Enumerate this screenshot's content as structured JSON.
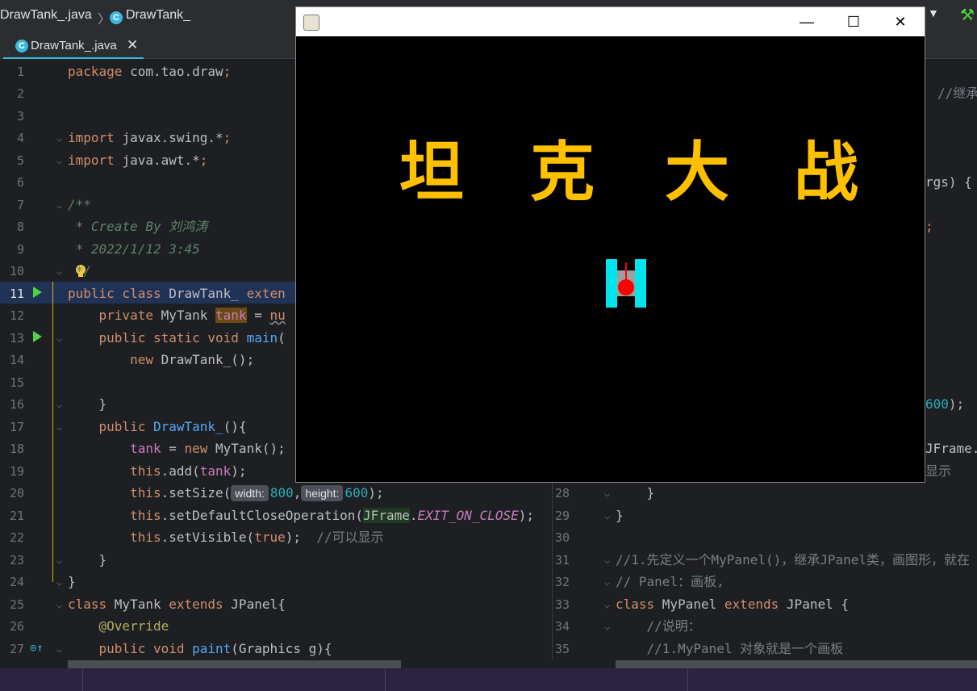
{
  "breadcrumb": {
    "file": "DrawTank_.java",
    "class": "DrawTank_",
    "sep": "〉"
  },
  "tab": {
    "label": "DrawTank_.java",
    "close": "✕"
  },
  "editor": {
    "line_numbers": [
      "1",
      "2",
      "3",
      "4",
      "5",
      "6",
      "7",
      "8",
      "9",
      "10",
      "11",
      "12",
      "13",
      "14",
      "15",
      "16",
      "17",
      "18",
      "19",
      "20",
      "21",
      "22",
      "23",
      "24",
      "25",
      "26",
      "27"
    ],
    "l1a": "package ",
    "l1b": "com.tao.draw",
    "l1c": ";",
    "l4a": "import ",
    "l4b": "javax.swing.*",
    "l4c": ";",
    "l5a": "import ",
    "l5b": "java.awt.*",
    "l5c": ";",
    "l7": "/**",
    "l8": " * Create By 刘鸿涛",
    "l9": " * 2022/1/12 3:45",
    "l10": " */",
    "l11a": "public class ",
    "l11b": "DrawTank_ ",
    "l11c": "exten",
    "l12a": "    private ",
    "l12b": "MyTank ",
    "l12c": "tank",
    "l12d": " = ",
    "l12e": "nu",
    "l13a": "    public static void ",
    "l13b": "main",
    "l13c": "(",
    "l14a": "        new ",
    "l14b": "DrawTank_",
    "l14c": "();",
    "l16": "    }",
    "l17a": "    public ",
    "l17b": "DrawTank_",
    "l17c": "(){",
    "l18a": "        ",
    "l18b": "tank",
    "l18c": " = ",
    "l18d": "new ",
    "l18e": "MyTank",
    "l18f": "();",
    "l19a": "        ",
    "l19b": "this",
    "l19c": ".add(",
    "l19d": "tank",
    "l19e": ");",
    "l20a": "        ",
    "l20b": "this",
    "l20c": ".setSize(",
    "l20h1": "width:",
    "l20n1": "800",
    "l20d": ",",
    "l20h2": "height:",
    "l20n2": "600",
    "l20e": ");",
    "l21a": "        ",
    "l21b": "this",
    "l21c": ".setDefaultCloseOperation(",
    "l21d": "JFrame",
    "l21e": ".",
    "l21f": "EXIT_ON_CLOSE",
    "l21g": ");",
    "l22a": "        ",
    "l22b": "this",
    "l22c": ".setVisible(",
    "l22d": "true",
    "l22e": ");  ",
    "l22f": "//可以显示",
    "l23": "    }",
    "l24": "}",
    "l25a": "class ",
    "l25b": "MyTank ",
    "l25c": "extends ",
    "l25d": "JPanel{",
    "l26": "    @Override",
    "l27a": "    public void ",
    "l27b": "paint",
    "l27c": "(Graphics g){"
  },
  "right": {
    "r115": "//继承",
    "r225": "rgs) {",
    "r280": ";",
    "r498": "600",
    "r498b": ");",
    "r553": "JFrame.",
    "r580": "显示",
    "n28": "28",
    "t28": "    }",
    "n29": "29",
    "t29": "}",
    "n30": "30",
    "n31": "31",
    "t31": "//1.先定义一个MyPanel()，继承JPanel类，画图形，就在",
    "n32": "32",
    "t32": "// Panel：画板,",
    "n33": "33",
    "t33a": "class ",
    "t33b": "MyPanel ",
    "t33c": "extends ",
    "t33d": "JPanel {",
    "n34": "34",
    "t34": "    //说明：",
    "n35": "35",
    "t35": "    //1.MyPanel 对象就是一个画板"
  },
  "window": {
    "title_chars": [
      "坦",
      "克",
      "大",
      "战"
    ],
    "minimize": "—",
    "maximize": "☐",
    "close": "✕",
    "title_color": "#ffc000",
    "tank_track_color": "#00e5ee",
    "tank_body_color": "#9e9e9e",
    "turret_color": "#ff0000"
  }
}
